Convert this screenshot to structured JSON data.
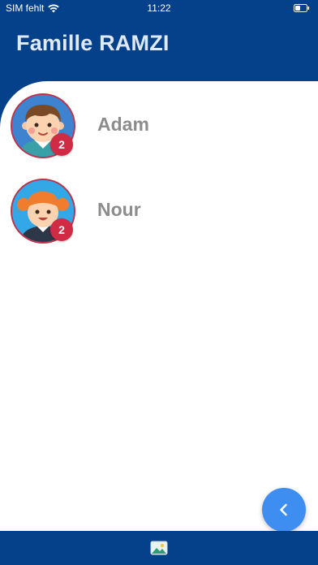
{
  "status_bar": {
    "carrier": "SIM fehlt",
    "time": "11:22",
    "icons": [
      "wifi-icon",
      "battery-icon"
    ]
  },
  "header": {
    "title": "Famille RAMZI"
  },
  "children": [
    {
      "name": "Adam",
      "badge": "2",
      "avatar": "boy-avatar"
    },
    {
      "name": "Nour",
      "badge": "2",
      "avatar": "girl-avatar"
    }
  ],
  "fab": {
    "icon": "chevron-left-icon"
  },
  "bottom_bar": {
    "icon": "image-icon"
  },
  "colors": {
    "primary": "#05408a",
    "accent": "#3d8ef0",
    "badge": "#d12a45",
    "name_text": "#8c8c8c"
  }
}
